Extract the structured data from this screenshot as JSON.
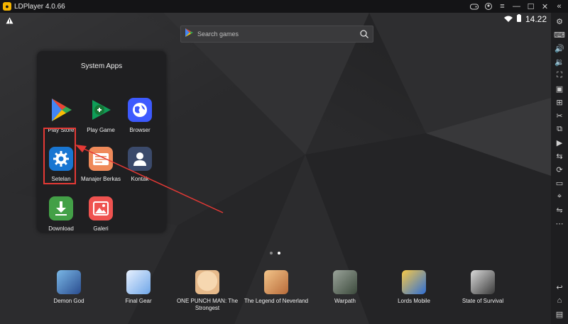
{
  "window": {
    "title": "LDPlayer 4.0.66"
  },
  "statusbar": {
    "time": "14.22"
  },
  "search": {
    "placeholder": "Search games"
  },
  "folder": {
    "title": "System Apps",
    "apps": [
      {
        "label": "Play Store",
        "icon": "play-store-icon"
      },
      {
        "label": "Play Game",
        "icon": "play-game-icon"
      },
      {
        "label": "Browser",
        "icon": "browser-icon"
      },
      {
        "label": "Setelan",
        "icon": "settings-gear-icon"
      },
      {
        "label": "Manajer Berkas",
        "icon": "file-manager-icon"
      },
      {
        "label": "Kontak",
        "icon": "contacts-icon"
      },
      {
        "label": "Download",
        "icon": "download-icon"
      },
      {
        "label": "Galeri",
        "icon": "gallery-icon"
      }
    ]
  },
  "dock": {
    "games": [
      {
        "label": "Demon God"
      },
      {
        "label": "Final Gear"
      },
      {
        "label": "ONE PUNCH MAN: The Strongest"
      },
      {
        "label": "The Legend of Neverland"
      },
      {
        "label": "Warpath"
      },
      {
        "label": "Lords Mobile"
      },
      {
        "label": "State of Survival"
      }
    ]
  },
  "colors": {
    "highlight": "#e53935",
    "arrow": "#e53935",
    "accent": "#f4b400"
  }
}
